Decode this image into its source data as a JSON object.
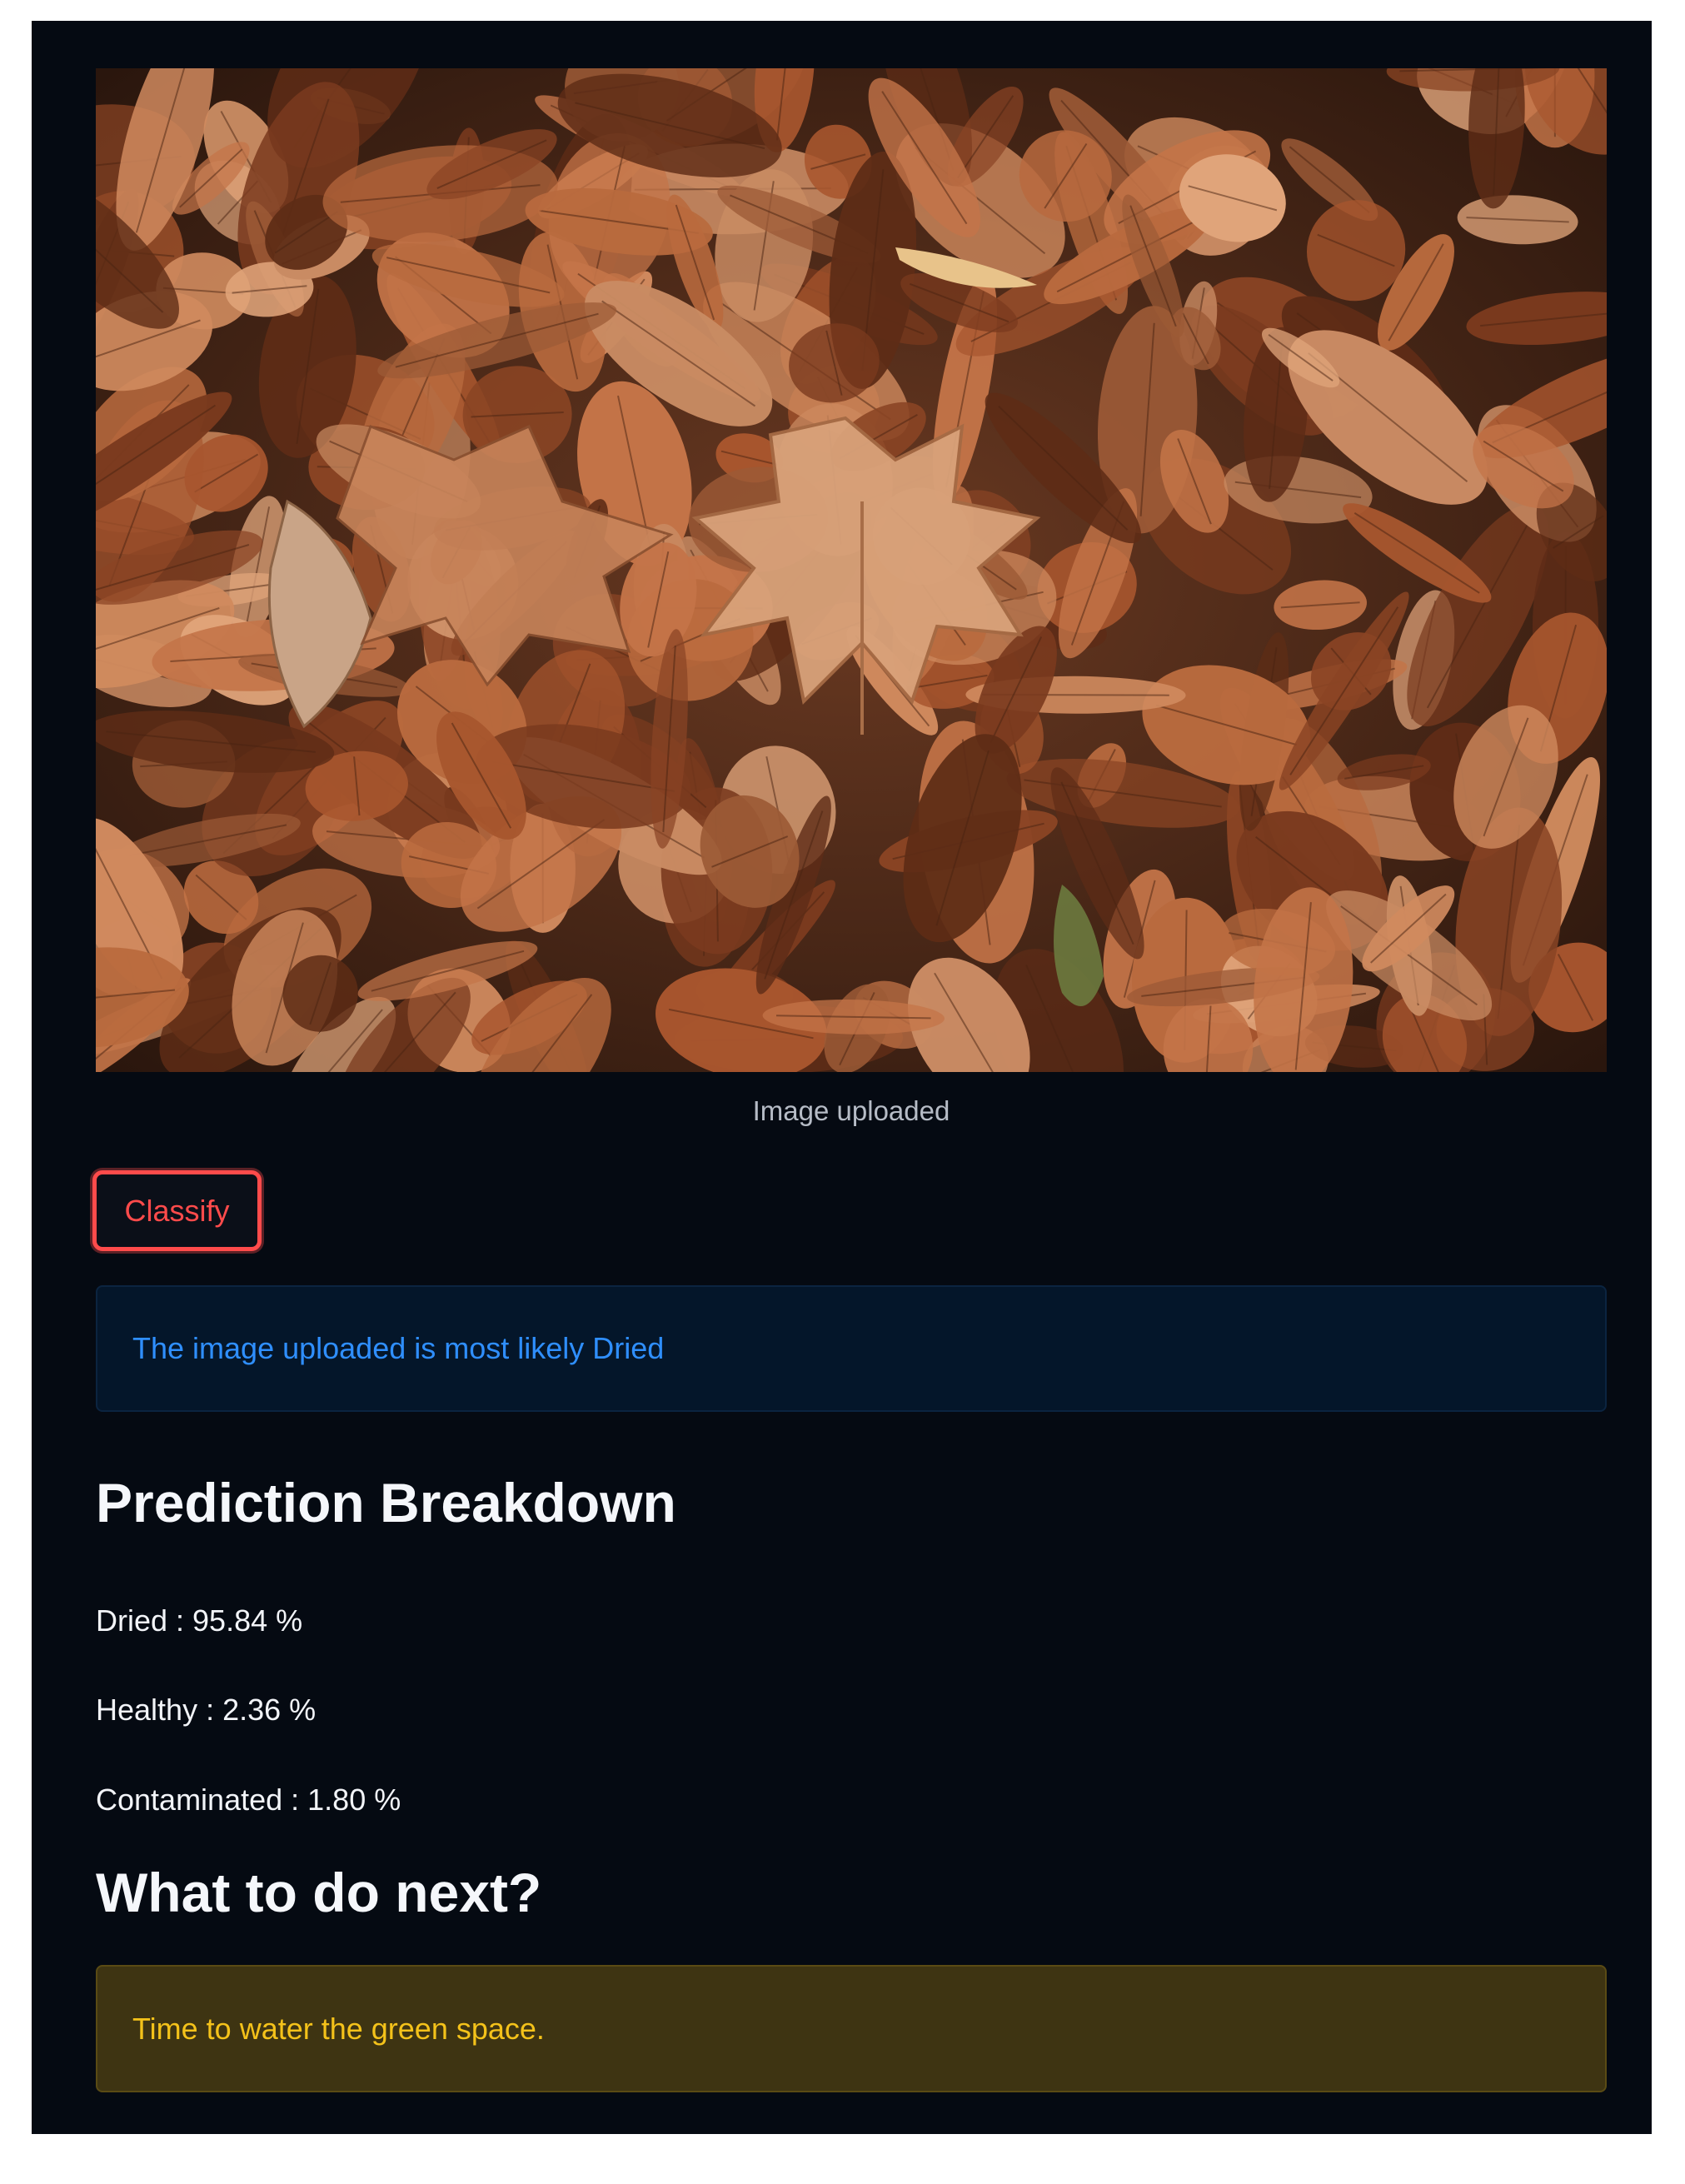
{
  "upload": {
    "caption": "Image uploaded"
  },
  "actions": {
    "classify_label": "Classify"
  },
  "result": {
    "message": "The image uploaded is most likely Dried"
  },
  "breakdown": {
    "title": "Prediction Breakdown",
    "items": [
      "Dried : 95.84 %",
      "Healthy : 2.36 %",
      "Contaminated : 1.80 %"
    ]
  },
  "next": {
    "title": "What to do next?",
    "advice": "Time to water the green space."
  },
  "colors": {
    "background": "#050a12",
    "primary_red": "#ff4b4b",
    "info_text": "#2f8fff",
    "info_bg": "#04162a",
    "warning_text": "#f4c21a",
    "warning_bg": "#3e3412"
  }
}
